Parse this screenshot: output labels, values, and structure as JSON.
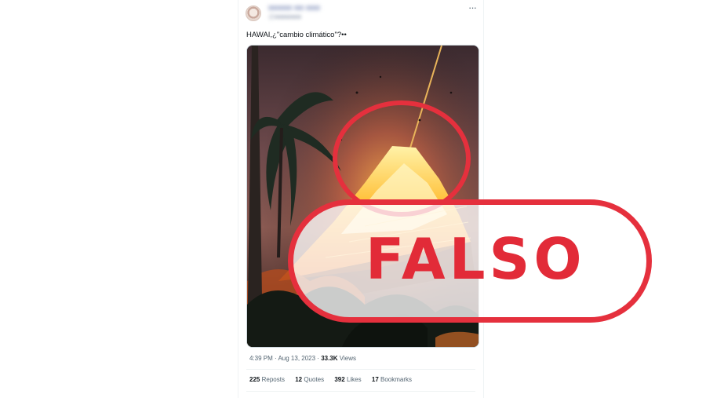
{
  "tweet": {
    "display_name": "■■■■■ ■■ ■■■",
    "handle": "@■■■■■■■",
    "more_label": "···",
    "text": "HAWAI,¿\"cambio climático\"?••",
    "timestamp": "4:39 PM · Aug 13, 2023 ·",
    "views_count": "33.3K",
    "views_label": "Views",
    "reposts_count": "225",
    "reposts_label": "Reposts",
    "quotes_count": "12",
    "quotes_label": "Quotes",
    "likes_count": "392",
    "likes_label": "Likes",
    "bookmarks_count": "17",
    "bookmarks_label": "Bookmarks"
  },
  "stamp": {
    "text": "FALSO",
    "color": "#e5303d"
  },
  "colors": {
    "text_primary": "#0f1419",
    "text_secondary": "#536471",
    "divider": "#eff3f4"
  }
}
